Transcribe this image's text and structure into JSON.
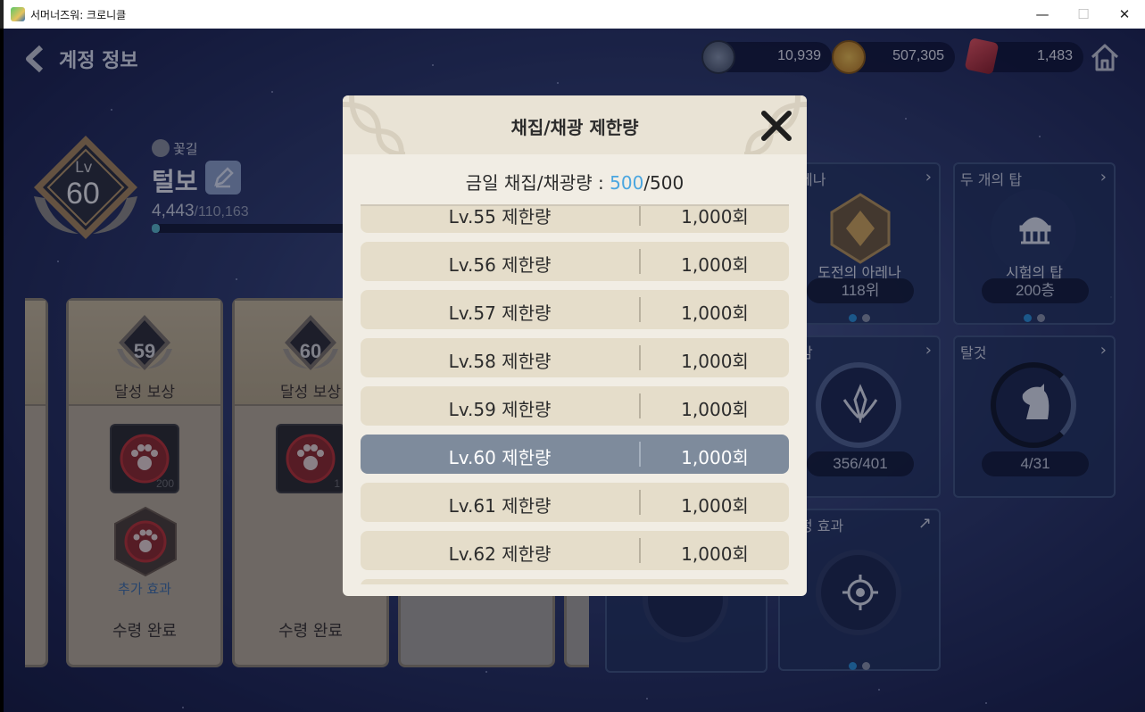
{
  "window": {
    "title": "서머너즈워: 크로니클",
    "minimize": "—",
    "maximize": "☐",
    "close": "✕"
  },
  "header": {
    "title": "계정 정보"
  },
  "currencies": [
    {
      "name": "crystal",
      "value": "10,939",
      "color": "#5d6b7f"
    },
    {
      "name": "gold",
      "value": "507,305",
      "color": "#d79a2a"
    },
    {
      "name": "ruby",
      "value": "1,483",
      "color": "#c5333c"
    }
  ],
  "profile": {
    "level_label": "Lv",
    "level": "60",
    "title_tag": "꽃길",
    "nickname": "털보",
    "exp_current": "4,443",
    "exp_max": "/110,163",
    "exp_progress": 0.04
  },
  "reward_cards": [
    {
      "level": "59",
      "title": "달성 보상",
      "item_count": "200",
      "extra": "추가 효과",
      "status": "수령 완료"
    },
    {
      "level": "60",
      "title": "달성 보상",
      "item_count": "1",
      "status": "수령 완료"
    }
  ],
  "tiles": [
    {
      "name": "…레나",
      "sub": "도전의 아레나",
      "pill": "118위"
    },
    {
      "name": "두 개의 탑",
      "sub": "시험의 탑",
      "pill": "200층"
    },
    {
      "name": "…감",
      "pill": "356/401"
    },
    {
      "name": "탈것",
      "pill": "4/31"
    },
    {
      "name": "…정 효과"
    }
  ],
  "modal": {
    "title": "채집/채광 제한량",
    "summary_label": "금일 채집/채광량 : ",
    "summary_current": "500",
    "summary_max": "/500",
    "rows": [
      {
        "label": "Lv.55 제한량",
        "value": "1,000회"
      },
      {
        "label": "Lv.56 제한량",
        "value": "1,000회"
      },
      {
        "label": "Lv.57 제한량",
        "value": "1,000회"
      },
      {
        "label": "Lv.58 제한량",
        "value": "1,000회"
      },
      {
        "label": "Lv.59 제한량",
        "value": "1,000회"
      },
      {
        "label": "Lv.60 제한량",
        "value": "1,000회",
        "selected": true
      },
      {
        "label": "Lv.61 제한량",
        "value": "1,000회"
      },
      {
        "label": "Lv.62 제한량",
        "value": "1,000회"
      }
    ]
  }
}
